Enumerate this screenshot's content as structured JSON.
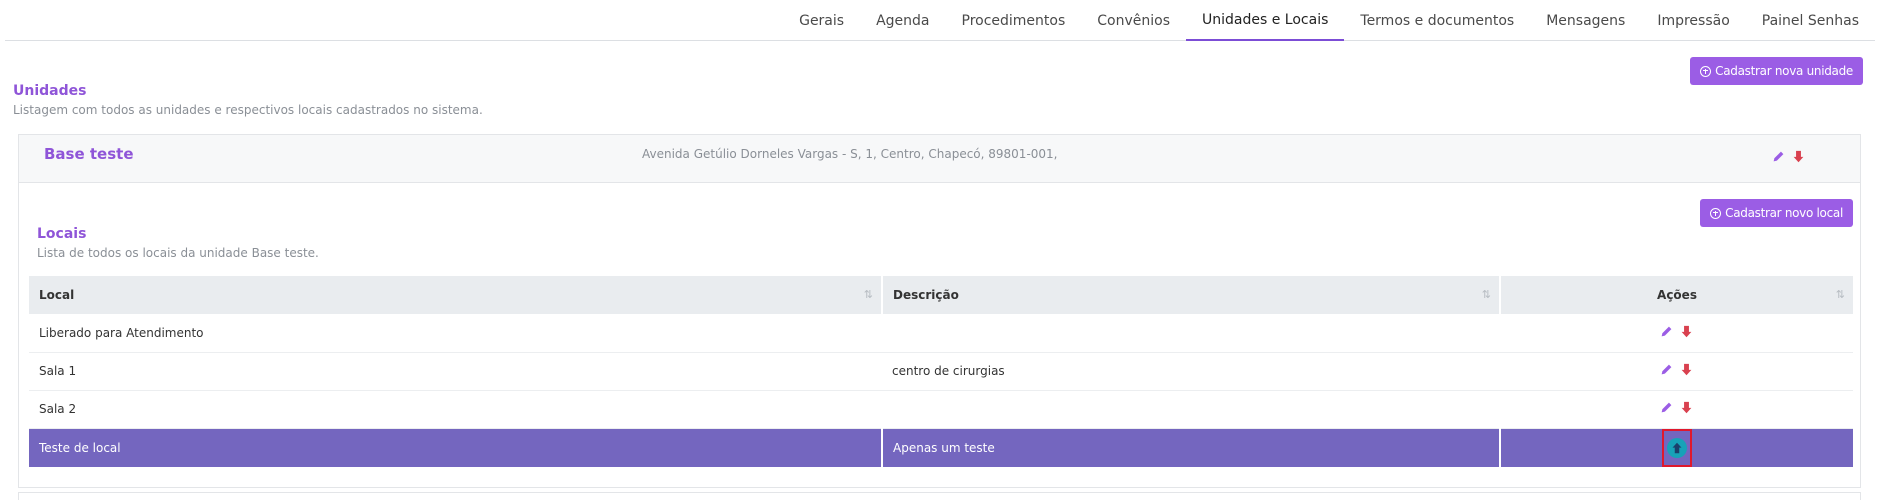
{
  "tabs": [
    {
      "label": "Gerais",
      "active": false
    },
    {
      "label": "Agenda",
      "active": false
    },
    {
      "label": "Procedimentos",
      "active": false
    },
    {
      "label": "Convênios",
      "active": false
    },
    {
      "label": "Unidades e Locais",
      "active": true
    },
    {
      "label": "Termos e documentos",
      "active": false
    },
    {
      "label": "Mensagens",
      "active": false
    },
    {
      "label": "Impressão",
      "active": false
    },
    {
      "label": "Painel Senhas",
      "active": false
    }
  ],
  "units": {
    "title": "Unidades",
    "subtitle": "Listagem com todos as unidades e respectivos locais cadastrados no sistema.",
    "new_button": "Cadastrar nova unidade"
  },
  "unit": {
    "name": "Base teste",
    "address": "Avenida Getúlio Dorneles Vargas - S, 1, Centro, Chapecó, 89801-001,"
  },
  "locals": {
    "title": "Locais",
    "subtitle": "Lista de todos os locais da unidade Base teste.",
    "new_button": "Cadastrar novo local",
    "columns": {
      "local": "Local",
      "description": "Descrição",
      "actions": "Ações"
    },
    "rows": [
      {
        "local": "Liberado para Atendimento",
        "description": ""
      },
      {
        "local": "Sala 1",
        "description": "centro de cirurgias"
      },
      {
        "local": "Sala 2",
        "description": ""
      },
      {
        "local": "Teste de local",
        "description": "Apenas um teste"
      }
    ]
  },
  "colors": {
    "accent": "#9b5de5",
    "selected_row": "#7466bf",
    "delete": "#d9414f",
    "up_button": "#17a2b8"
  }
}
